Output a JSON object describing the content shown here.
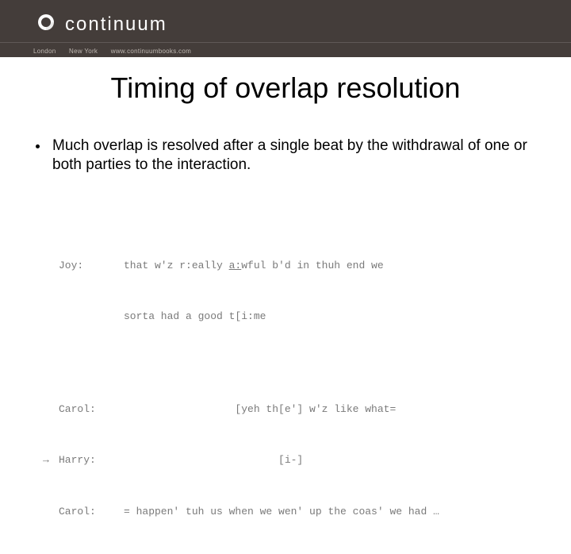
{
  "header": {
    "brand": "continuum",
    "meta": {
      "city1": "London",
      "city2": "New York",
      "url": "www.continuumbooks.com"
    }
  },
  "title": "Timing of overlap resolution",
  "bullets": [
    "Much overlap is resolved after a single beat by the withdrawal of one or both parties to the interaction."
  ],
  "transcript": [
    {
      "arrow": "",
      "speaker": "Joy:",
      "utt_pre": "that w'z r:eally ",
      "utt_u": "a:",
      "utt_post": "wful b'd in thuh end we"
    },
    {
      "arrow": "",
      "speaker": "",
      "utt_pre": "sorta had a good t[i:me",
      "utt_u": "",
      "utt_post": ""
    },
    {
      "arrow": "",
      "speaker": "Carol:",
      "utt_pre": "                  [yeh th[e'] w'z like what=",
      "utt_u": "",
      "utt_post": ""
    },
    {
      "arrow": "→",
      "speaker": "Harry:",
      "utt_pre": "                         [i-]",
      "utt_u": "",
      "utt_post": ""
    },
    {
      "arrow": "",
      "speaker": "Carol:",
      "utt_pre": "= happen' tuh us when we wen' up the coas' we had …",
      "utt_u": "",
      "utt_post": ""
    }
  ]
}
